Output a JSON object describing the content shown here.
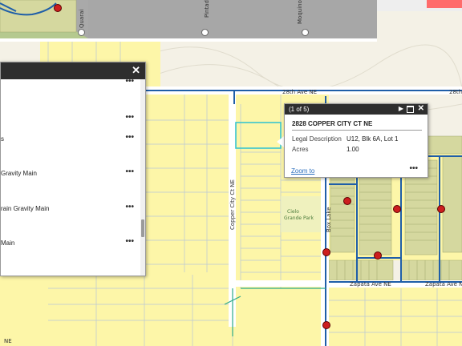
{
  "map": {
    "streets": {
      "ave_28": "28th Ave NE",
      "ave_28_right": "28th",
      "copper_city": "Copper City Ct NE",
      "box_lake": "Box Lake",
      "zapata_1": "Zapata Ave NE",
      "zapata_2": "Zapata Ave NE",
      "quarai": "Quarai",
      "pintada": "Pintada",
      "moquino": "Moquino",
      "ne_bottom": "NE"
    },
    "park_label_1": "Cielo",
    "park_label_2": "Grande Park",
    "colors": {
      "parcel_fill": "#fdf6a8",
      "parcel_line": "#b8c6d6",
      "water_main": "#1f5ea8",
      "selected_parcel": "#39c5cf",
      "building_grey": "#a9a9a9",
      "green_lot": "#d5d89f",
      "green_line": "#2aa98a"
    }
  },
  "layer_panel": {
    "close_icon": "close-icon",
    "items": [
      {
        "label": "",
        "menu": "•••"
      },
      {
        "label": "",
        "menu": "•••"
      },
      {
        "label": "s",
        "menu": "•••"
      },
      {
        "label": "Gravity Main",
        "menu": "•••"
      },
      {
        "label": "rain Gravity Main",
        "menu": "•••"
      },
      {
        "label": "Main",
        "menu": "•••"
      }
    ]
  },
  "popup": {
    "count": "(1 of 5)",
    "title": "2828 COPPER CITY CT NE",
    "attributes": [
      {
        "name": "Legal Description",
        "value": "U12, Blk 6A, Lot 1"
      },
      {
        "name": "Acres",
        "value": "1.00"
      }
    ],
    "zoom_label": "Zoom to",
    "menu": "•••",
    "next_icon": "next-feature-icon",
    "maximize_icon": "maximize-icon",
    "close_icon": "close-icon"
  }
}
